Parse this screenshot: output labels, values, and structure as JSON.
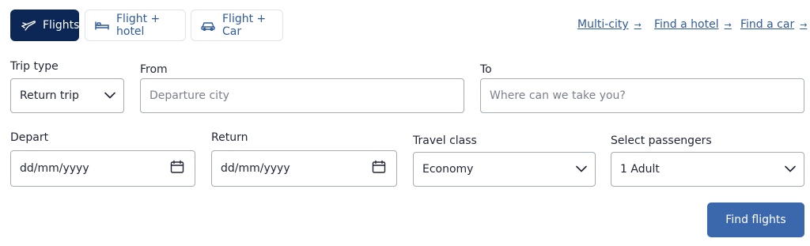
{
  "tabs": [
    {
      "label": "Flights",
      "icon": "plane-icon",
      "active": true
    },
    {
      "label": "Flight + hotel",
      "icon": "bed-icon",
      "active": false
    },
    {
      "label": "Flight + Car",
      "icon": "car-icon",
      "active": false
    }
  ],
  "links": [
    {
      "label": "Multi-city",
      "arrow": "→"
    },
    {
      "label": "Find a hotel",
      "arrow": "→"
    },
    {
      "label": "Find a car",
      "arrow": "→"
    }
  ],
  "form": {
    "trip_type": {
      "label": "Trip type",
      "value": "Return trip"
    },
    "from": {
      "label": "From",
      "placeholder": "Departure city"
    },
    "to": {
      "label": "To",
      "placeholder": "Where can we take you?"
    },
    "depart": {
      "label": "Depart",
      "placeholder": "dd/mm/yyyy"
    },
    "return": {
      "label": "Return",
      "placeholder": "dd/mm/yyyy"
    },
    "travel_class": {
      "label": "Travel class",
      "value": "Economy"
    },
    "passengers": {
      "label": "Select passengers",
      "value": "1 Adult"
    }
  },
  "submit_label": "Find flights",
  "colors": {
    "active_tab_bg": "#0c2755",
    "link": "#2f5a9c",
    "button_bg": "#3b67ad",
    "field_border": "#a6acb6"
  }
}
